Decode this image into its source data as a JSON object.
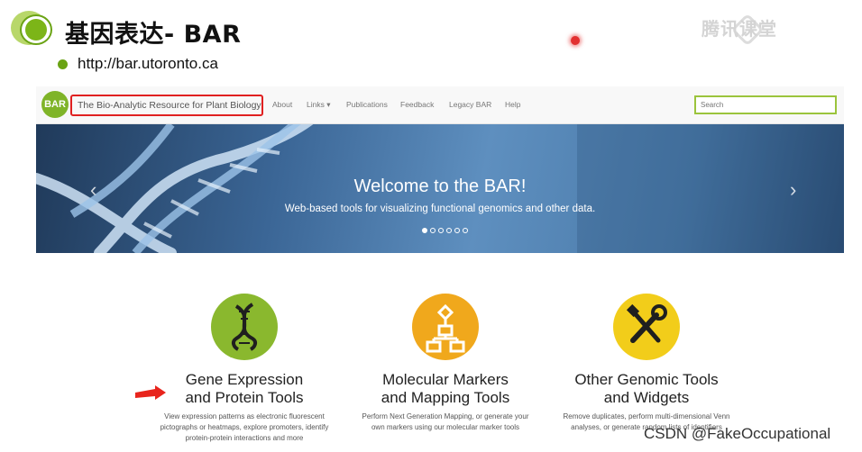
{
  "slide": {
    "title": "基因表达- BAR",
    "bullet": "http://bar.utoronto.ca",
    "watermark": "腾讯课堂"
  },
  "navbar": {
    "logo": "BAR",
    "brand": "The Bio-Analytic Resource for Plant Biology",
    "links": [
      "About",
      "Links ▾",
      "Publications",
      "Feedback",
      "Legacy BAR",
      "Help"
    ],
    "search_placeholder": "Search"
  },
  "hero": {
    "title": "Welcome to the BAR!",
    "subtitle": "Web-based tools for visualizing functional genomics and other data.",
    "slide_count": 6,
    "active_slide": 1
  },
  "features": [
    {
      "title_line1": "Gene Expression",
      "title_line2": "and Protein Tools",
      "desc_line1": "View expression patterns as electronic fluorescent",
      "desc_line2": "pictographs or heatmaps, explore promoters, identify",
      "desc_line3": "protein-protein interactions and more",
      "icon": "dna-icon",
      "color": "#8ab82e"
    },
    {
      "title_line1": "Molecular Markers",
      "title_line2": "and Mapping Tools",
      "desc_line1": "Perform Next Generation Mapping, or generate your",
      "desc_line2": "own markers using our molecular marker tools",
      "desc_line3": "",
      "icon": "flowchart-icon",
      "color": "#f0a81c"
    },
    {
      "title_line1": "Other Genomic Tools",
      "title_line2": "and Widgets",
      "desc_line1": "Remove duplicates, perform multi-dimensional Venn",
      "desc_line2": "analyses, or generate random lists of identifiers",
      "desc_line3": "",
      "icon": "tools-icon",
      "color": "#f2cd1a"
    }
  ],
  "footer_watermark": "CSDN @FakeOccupational",
  "colors": {
    "accent_green": "#7cb518",
    "highlight_red": "#e02020"
  }
}
